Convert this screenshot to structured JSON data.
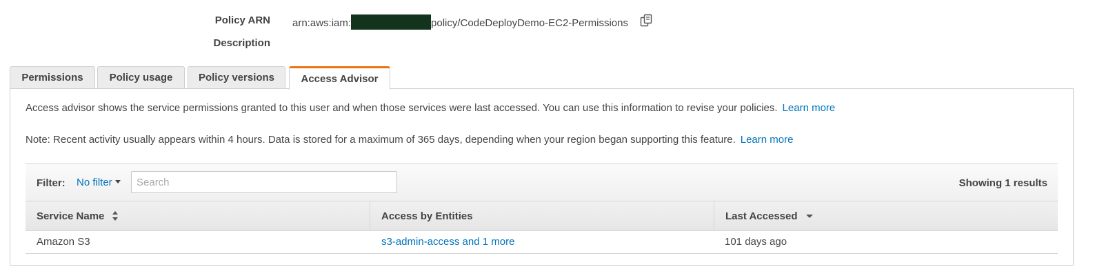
{
  "summary": {
    "arn_label": "Policy ARN",
    "arn_prefix": "arn:aws:iam:",
    "arn_suffix": "policy/CodeDeployDemo-EC2-Permissions",
    "description_label": "Description"
  },
  "tabs": [
    {
      "label": "Permissions"
    },
    {
      "label": "Policy usage"
    },
    {
      "label": "Policy versions"
    },
    {
      "label": "Access Advisor",
      "active": true
    }
  ],
  "advisor": {
    "intro": "Access advisor shows the service permissions granted to this user and when those services were last accessed. You can use this information to revise your policies.",
    "intro_link": "Learn more",
    "note": "Note: Recent activity usually appears within 4 hours. Data is stored for a maximum of 365 days, depending when your region began supporting this feature.",
    "note_link": "Learn more"
  },
  "filter": {
    "label": "Filter:",
    "selected": "No filter",
    "search_placeholder": "Search",
    "showing": "Showing 1 results"
  },
  "table": {
    "columns": [
      "Service Name",
      "Access by Entities",
      "Last Accessed"
    ],
    "rows": [
      {
        "service": "Amazon S3",
        "entities": "s3-admin-access and 1 more",
        "last_accessed": "101 days ago"
      }
    ]
  },
  "colors": {
    "accent_tab": "#ec7211",
    "link": "#0073bb",
    "redaction": "#12331c"
  }
}
